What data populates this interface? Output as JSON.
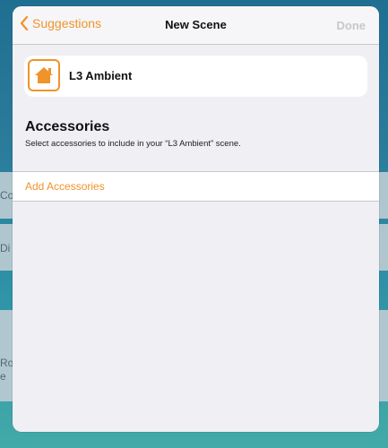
{
  "background": {
    "peek_texts": [
      "Co",
      "Di",
      "Roo",
      "e"
    ]
  },
  "navbar": {
    "back_label": "Suggestions",
    "title": "New Scene",
    "done_label": "Done"
  },
  "scene": {
    "name": "L3 Ambient",
    "icon": "house-icon"
  },
  "accessories": {
    "title": "Accessories",
    "subtitle": "Select accessories to include in your “L3 Ambient” scene.",
    "add_label": "Add Accessories"
  },
  "colors": {
    "accent": "#f0932b",
    "disabled": "#c7c7cc",
    "modal_bg": "#efeff4"
  }
}
